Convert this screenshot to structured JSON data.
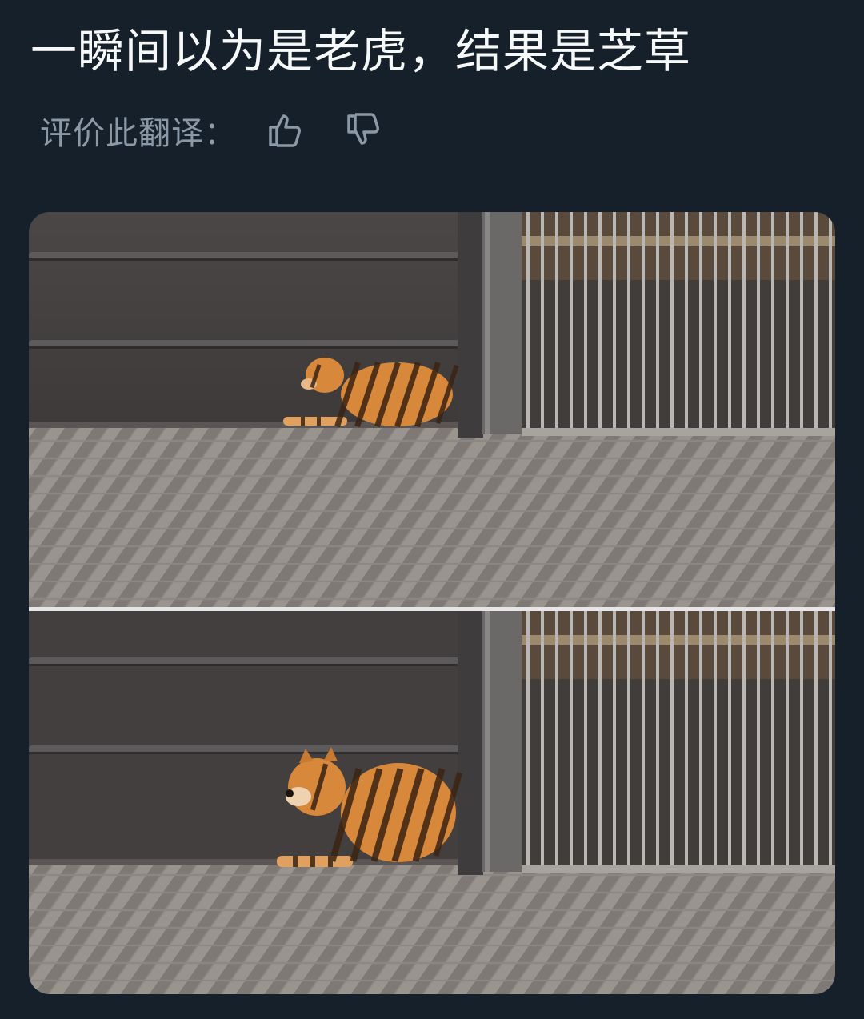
{
  "post": {
    "text": "一瞬间以为是老虎，结果是芝草"
  },
  "translation_rating": {
    "label": "评价此翻译：",
    "thumbs_up_icon": "thumbs-up-icon",
    "thumbs_down_icon": "thumbs-down-icon"
  },
  "media": {
    "type": "image",
    "panels": [
      "shiba-dog-striped-shadow-top",
      "shiba-dog-striped-shadow-bottom"
    ]
  },
  "colors": {
    "background": "#15202b",
    "text_primary": "#f7f9f9",
    "text_secondary": "#8b98a5",
    "dog_fur": "#d8883a",
    "stripe_shadow": "#3a2413"
  }
}
